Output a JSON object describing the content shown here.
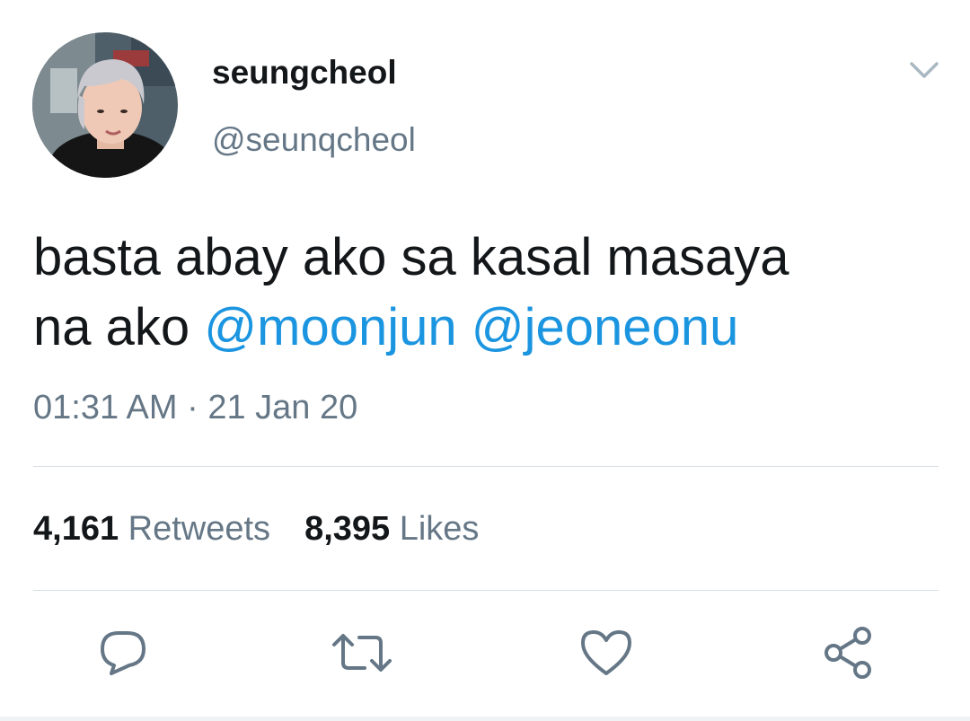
{
  "user": {
    "name": "seungcheol",
    "handle": "@seunqcheol"
  },
  "tweet": {
    "text_line1": "basta abay ako sa kasal masaya",
    "text_line2_prefix": "na ako ",
    "mention1": "@moonjun",
    "mention2": "@jeoneonu",
    "time": "01:31 AM",
    "separator": "·",
    "date": "21 Jan 20"
  },
  "stats": {
    "retweets_count": "4,161",
    "retweets_label": "Retweets",
    "likes_count": "8,395",
    "likes_label": "Likes"
  },
  "icons": {
    "more": "chevron-down-icon",
    "reply": "reply-icon",
    "retweet": "retweet-icon",
    "like": "heart-icon",
    "share": "share-icon"
  },
  "colors": {
    "mention": "#1b95e0",
    "icon": "#657786",
    "secondary_text": "#657786"
  }
}
